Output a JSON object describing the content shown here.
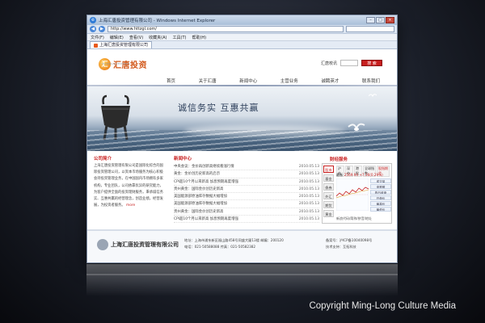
{
  "browser": {
    "title": "上海汇唐投资管理有限公司 - Windows Internet Explorer",
    "url": "http://www.httzgl.com/",
    "tab_label": "上海汇唐投资管理有限公司",
    "menu": [
      "文件(F)",
      "编辑(E)",
      "查看(V)",
      "收藏夹(A)",
      "工具(T)",
      "帮助(H)"
    ]
  },
  "site": {
    "logo_text": "汇唐投资",
    "logo_subtext": "HUITANG INVESTMENT",
    "search_label": "汇唐校讯",
    "search_button": "搜 索",
    "nav": [
      "首页",
      "关于汇唐",
      "新闻中心",
      "主营业务",
      "诚聘英才",
      "联系我们"
    ],
    "slogan": "诚信务实  互惠共赢",
    "intro_title": "公司简介",
    "intro_text": "上海汇唐投资管理有限公司是国际化综合的国际投资管理公司，以资本市场服务为核心积极会持投资管理业务，在中国国内市场拥有多家机构，专业团队，公司依靠优异的研究能力，为客户提供全面的投资理财服务，秉承诚信务实、互惠共赢的经营理念，创造业绩，经营发展，为投资者服务。",
    "intro_more": "more",
    "news_title": "新闻中心",
    "news": [
      {
        "title": "中央会议：金价再创新高继续看涨行情",
        "date": "2010.05.13"
      },
      {
        "title": "黄金：金价创历史新高的启示",
        "date": "2010.05.13"
      },
      {
        "title": "CPI超10个月以来新高 加息预期再度增强",
        "date": "2010.05.13"
      },
      {
        "title": "贵州黄金：国际金价创历史新高",
        "date": "2010.05.13"
      },
      {
        "title": "美国能源部原油库存数据大幅增加",
        "date": "2010.05.13"
      },
      {
        "title": "美国能源部原油库存数据大幅增加",
        "date": "2010.05.13"
      },
      {
        "title": "贵州黄金：国际金价创历史新高",
        "date": "2010.05.13"
      },
      {
        "title": "CPI超10个月以来新高 加息预期再度增强",
        "date": "2010.05.13"
      },
      {
        "title": "黄金：金价创历史新高的启示",
        "date": "2010.05.13"
      }
    ],
    "finance_title": "财经服务",
    "finance_side": [
      "股市",
      "基金",
      "债券",
      "外汇",
      "期货",
      "黄金"
    ],
    "finance_tabs": [
      "沪市",
      "深市",
      "港股",
      "全球指数",
      "美股"
    ],
    "finance_hot": "股指期货",
    "finance_quote_label": "最新",
    "finance_quote_value": "2569.94",
    "finance_quote_change": "+7.36(0.29%)",
    "finance_rows": [
      "成交量",
      "涨跌额",
      "昨日收盘",
      "开盘价",
      "最高价",
      "最低价",
      "成交额",
      "换手率"
    ],
    "finance_footer": "新浪代码/简称/拼音/地址",
    "footer_company": "上海汇唐投资管理有限公司",
    "footer_address": "地址：上海市浦东新区福山路458号同盛大厦13楼 邮编：200120",
    "footer_phone": "电话：021-50588088 传真：021-50582382",
    "footer_icp": "备案号：沪ICP备10040098号",
    "footer_support": "技术支持：互拓科技",
    "copyright": "Copyright  Ming-Long Culture Media"
  },
  "colors": {
    "brand_red": "#c81f1f",
    "brand_orange": "#d2581a",
    "chrome_blue": "#a9bfd9"
  }
}
